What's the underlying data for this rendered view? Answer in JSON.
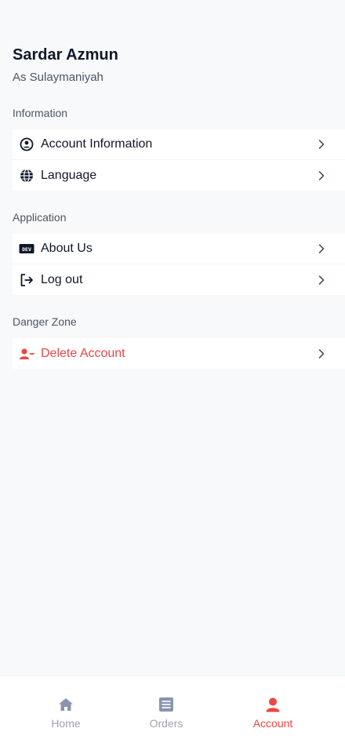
{
  "profile": {
    "name": "Sardar Azmun",
    "city": "As Sulaymaniyah"
  },
  "sections": {
    "information": {
      "title": "Information",
      "items": [
        {
          "label": "Account Information",
          "icon": "account-circle-icon"
        },
        {
          "label": "Language",
          "icon": "globe-icon"
        }
      ]
    },
    "application": {
      "title": "Application",
      "items": [
        {
          "label": "About Us",
          "icon": "dev-badge-icon"
        },
        {
          "label": "Log out",
          "icon": "logout-icon"
        }
      ]
    },
    "danger": {
      "title": "Danger Zone",
      "items": [
        {
          "label": "Delete Account",
          "icon": "user-remove-icon"
        }
      ]
    }
  },
  "tabs": [
    {
      "label": "Home",
      "icon": "home-icon",
      "active": false
    },
    {
      "label": "Orders",
      "icon": "list-icon",
      "active": false
    },
    {
      "label": "Account",
      "icon": "user-icon",
      "active": true
    }
  ],
  "colors": {
    "accent": "#ef4444",
    "text": "#111827",
    "muted": "#9ca3af",
    "background": "#f8f9fb"
  }
}
